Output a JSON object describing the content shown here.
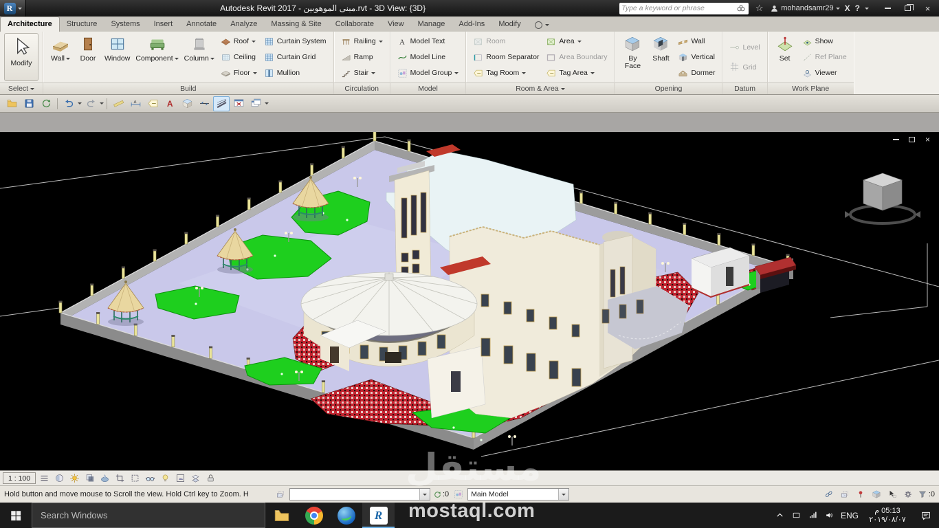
{
  "watermark": {
    "ar": "مستقل",
    "en": "mostaql.com"
  },
  "icons": {
    "star": "☆",
    "help": "?",
    "close": "×",
    "exchange": "X",
    "revit_logo": "R"
  },
  "titlebar": {
    "title": "Autodesk Revit 2017 - مبنى الموهوبين.rvt - 3D View: {3D}",
    "search_placeholder": "Type a keyword or phrase",
    "username": "mohandsamr29"
  },
  "tabs": {
    "items": [
      "Architecture",
      "Structure",
      "Systems",
      "Insert",
      "Annotate",
      "Analyze",
      "Massing & Site",
      "Collaborate",
      "View",
      "Manage",
      "Add-Ins",
      "Modify"
    ],
    "active": "Architecture"
  },
  "ribbon": {
    "modify": "Modify",
    "select": "Select",
    "build": {
      "label": "Build",
      "wall": "Wall",
      "door": "Door",
      "window": "Window",
      "component": "Component",
      "column": "Column",
      "roof": "Roof",
      "ceiling": "Ceiling",
      "floor": "Floor",
      "curtain_system": "Curtain System",
      "curtain_grid": "Curtain Grid",
      "mullion": "Mullion"
    },
    "circulation": {
      "label": "Circulation",
      "railing": "Railing",
      "ramp": "Ramp",
      "stair": "Stair"
    },
    "model": {
      "label": "Model",
      "text": "Model Text",
      "line": "Model Line",
      "group": "Model Group"
    },
    "room_area": {
      "label": "Room & Area",
      "room": "Room",
      "separator": "Room Separator",
      "tag_room": "Tag Room",
      "area": "Area",
      "boundary": "Area Boundary",
      "tag_area": "Tag Area"
    },
    "opening": {
      "label": "Opening",
      "by_face": "By Face",
      "shaft": "Shaft",
      "wall": "Wall",
      "vertical": "Vertical",
      "dormer": "Dormer"
    },
    "datum": {
      "label": "Datum",
      "level": "Level",
      "grid": "Grid"
    },
    "work_plane": {
      "label": "Work Plane",
      "set": "Set",
      "show": "Show",
      "ref_plane": "Ref Plane",
      "viewer": "Viewer"
    }
  },
  "qat": {
    "buttons": [
      "open",
      "save",
      "synchronize-with-central",
      "undo",
      "redo",
      "measure",
      "aligned-dimension",
      "tag-by-category",
      "text",
      "default-3d-view",
      "section",
      "thin-lines",
      "close-hidden-windows",
      "switch-windows"
    ]
  },
  "viewport": {
    "scale": "1 : 100",
    "vcb_icons": [
      "detail-level",
      "visual-style",
      "sun-path",
      "shadows",
      "show-rendering-dialog",
      "crop-view",
      "show-crop-region",
      "temporary-hide-isolate",
      "reveal-hidden-elements",
      "temporary-view-properties",
      "displacement-sets",
      "reveal-constraints"
    ]
  },
  "statusbar": {
    "message": "Hold button and move mouse to Scroll the view. Hold Ctrl key to Zoom. H",
    "badge": ":0",
    "design_option": "Main Model",
    "filter_count": ":0",
    "right_icons": [
      "select-links",
      "select-underlay",
      "select-pinned",
      "select-by-face",
      "drag-on-selection",
      "settings",
      "filter"
    ]
  },
  "taskbar": {
    "search_placeholder": "Search Windows",
    "apps": [
      "file-explorer",
      "chrome",
      "blue-app",
      "revit"
    ],
    "language": "ENG",
    "time": "05:13 م",
    "date": "٢٠١٩/٠٨/٠٧"
  }
}
